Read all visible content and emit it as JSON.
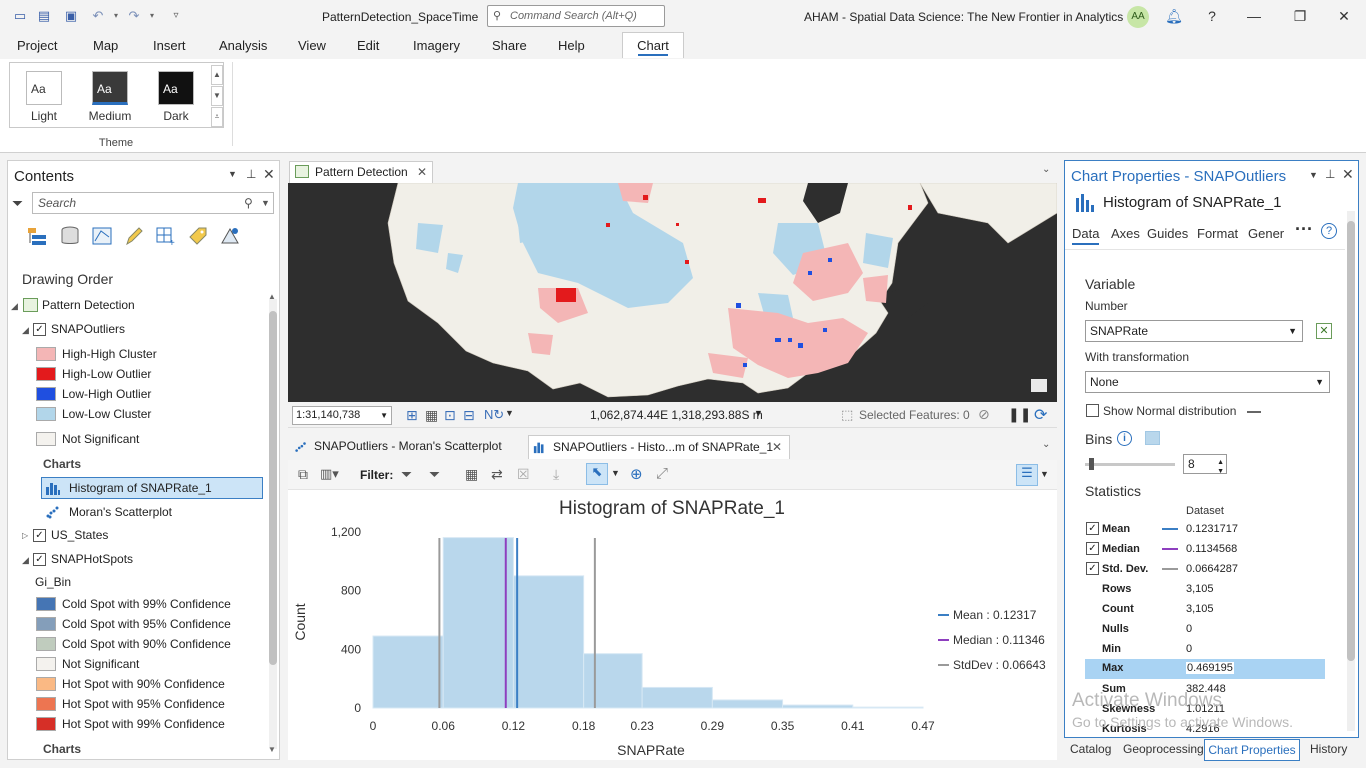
{
  "title_bar": {
    "document": "PatternDetection_SpaceTime",
    "command_search_placeholder": "Command Search (Alt+Q)",
    "app_title": "AHAM - Spatial Data Science:  The New Frontier in Analytics",
    "user_initials": "AA"
  },
  "menu": [
    "Project",
    "Map",
    "Insert",
    "Analysis",
    "View",
    "Edit",
    "Imagery",
    "Share",
    "Help",
    "Chart"
  ],
  "ribbon": {
    "themes": [
      {
        "label": "Light",
        "sample": "Aa"
      },
      {
        "label": "Medium",
        "sample": "Aa"
      },
      {
        "label": "Dark",
        "sample": "Aa"
      }
    ],
    "group_label": "Theme"
  },
  "contents": {
    "title": "Contents",
    "search_placeholder": "Search",
    "drawing_order": "Drawing Order",
    "map_name": "Pattern Detection",
    "layer1": {
      "name": "SNAPOutliers",
      "legend": [
        {
          "label": "High-High Cluster",
          "color": "#f4b6b6"
        },
        {
          "label": "High-Low Outlier",
          "color": "#e31a1c"
        },
        {
          "label": "Low-High Outlier",
          "color": "#1f4fe0"
        },
        {
          "label": "Low-Low Cluster",
          "color": "#b2d6ea"
        },
        {
          "label": "Not Significant",
          "color": "#f4f2ee"
        }
      ],
      "charts_label": "Charts",
      "charts": [
        "Histogram of SNAPRate_1",
        "Moran's Scatterplot"
      ]
    },
    "layer2": {
      "name": "US_States"
    },
    "layer3": {
      "name": "SNAPHotSpots",
      "field": "Gi_Bin",
      "legend": [
        {
          "label": "Cold Spot with 99% Confidence",
          "color": "#4575b4"
        },
        {
          "label": "Cold Spot with 95% Confidence",
          "color": "#849eba"
        },
        {
          "label": "Cold Spot with 90% Confidence",
          "color": "#c0ccbe"
        },
        {
          "label": "Not Significant",
          "color": "#f4f2ee"
        },
        {
          "label": "Hot Spot with 90% Confidence",
          "color": "#fab984"
        },
        {
          "label": "Hot Spot with 95% Confidence",
          "color": "#ed7551"
        },
        {
          "label": "Hot Spot with 99% Confidence",
          "color": "#d62f27"
        }
      ],
      "charts_label": "Charts"
    }
  },
  "map": {
    "tab": "Pattern Detection",
    "scale": "1:31,140,738",
    "coordinates": "1,062,874.44E 1,318,293.88S m",
    "selected_features": "Selected Features: 0"
  },
  "chart_tabs": [
    "SNAPOutliers - Moran's Scatterplot",
    "SNAPOutliers - Histo...m of SNAPRate_1"
  ],
  "chart_toolbar": {
    "filter_label": "Filter:"
  },
  "chart_data": {
    "type": "bar",
    "title": "Histogram of SNAPRate_1",
    "xlabel": "SNAPRate",
    "ylabel": "Count",
    "bin_edges": [
      0,
      0.06,
      0.12,
      0.18,
      0.23,
      0.29,
      0.35,
      0.41,
      0.47
    ],
    "x_tick_labels": [
      "0",
      "0.06",
      "0.12",
      "0.18",
      "0.23",
      "0.29",
      "0.35",
      "0.41",
      "0.47"
    ],
    "xlim": [
      0,
      0.47
    ],
    "values": [
      490,
      1160,
      900,
      370,
      140,
      55,
      20,
      6
    ],
    "y_ticks": [
      0,
      400,
      800,
      1200
    ],
    "y_tick_labels": [
      "0",
      "400",
      "800",
      "1,200"
    ],
    "ylim": [
      0,
      1280
    ],
    "bar_color": "#b9d7ec",
    "guides": [
      {
        "label": "Mean : 0.12317",
        "value": 0.12317,
        "color": "#3b7fc4"
      },
      {
        "label": "Median : 0.11346",
        "value": 0.11346,
        "color": "#8e3fbf"
      },
      {
        "label": "StdDev : 0.06643",
        "values": [
          0.05674,
          0.1896
        ],
        "color": "#9a9a9a"
      }
    ]
  },
  "chart_properties": {
    "title": "Chart Properties - SNAPOutliers",
    "chart_name": "Histogram of SNAPRate_1",
    "tabs": [
      "Data",
      "Axes",
      "Guides",
      "Format",
      "Gener"
    ],
    "variable_head": "Variable",
    "number_label": "Number",
    "number_value": "SNAPRate",
    "transformation_label": "With transformation",
    "transformation_value": "None",
    "normal_dist_label": "Show Normal distribution",
    "bins_label": "Bins",
    "bins_value": "8",
    "bins_slider_fraction": 0.07,
    "statistics_head": "Statistics",
    "dataset_label": "Dataset",
    "stats_checked": [
      {
        "label": "Mean",
        "value": "0.1231717",
        "color": "#3b7fc4"
      },
      {
        "label": "Median",
        "value": "0.1134568",
        "color": "#8e3fbf"
      },
      {
        "label": "Std. Dev.",
        "value": "0.0664287",
        "color": "#9a9a9a"
      }
    ],
    "stats": [
      {
        "label": "Rows",
        "value": "3,105"
      },
      {
        "label": "Count",
        "value": "3,105"
      },
      {
        "label": "Nulls",
        "value": "0"
      },
      {
        "label": "Min",
        "value": "0"
      },
      {
        "label": "Max",
        "value": "0.469195"
      },
      {
        "label": "Sum",
        "value": "382.448"
      },
      {
        "label": "Skewness",
        "value": "1.01211"
      },
      {
        "label": "Kurtosis",
        "value": "4.2916"
      }
    ]
  },
  "watermark": {
    "line1": "Activate Windows",
    "line2": "Go to Settings to activate Windows."
  },
  "bottom_tabs": [
    "Catalog",
    "Geoprocessing",
    "Chart Properties",
    "History"
  ]
}
